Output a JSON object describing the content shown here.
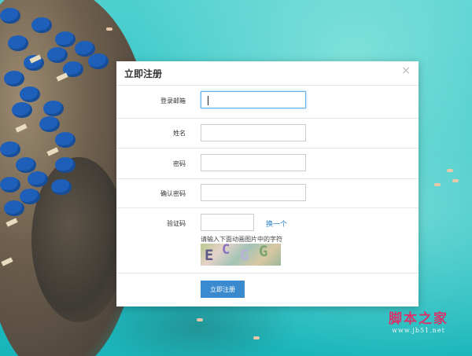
{
  "modal": {
    "title": "立即注册",
    "close_label": "×"
  },
  "form": {
    "email_label": "登录邮箱",
    "name_label": "姓名",
    "password_label": "密码",
    "confirm_label": "确认密码",
    "captcha_label": "验证码",
    "email_value": "",
    "name_value": "",
    "password_value": "",
    "confirm_value": "",
    "captcha_value": "",
    "refresh_label": "换一个",
    "captcha_hint": "请输入下面动画图片中的字符",
    "captcha_chars": [
      "E",
      "C",
      "G",
      "G"
    ],
    "submit_label": "立即注册"
  },
  "watermark": {
    "top": "脚本之家",
    "bottom": "www.jb51.net"
  },
  "colors": {
    "accent": "#3a8ad0",
    "link": "#2a7fc5",
    "watermark": "#d6346a"
  }
}
